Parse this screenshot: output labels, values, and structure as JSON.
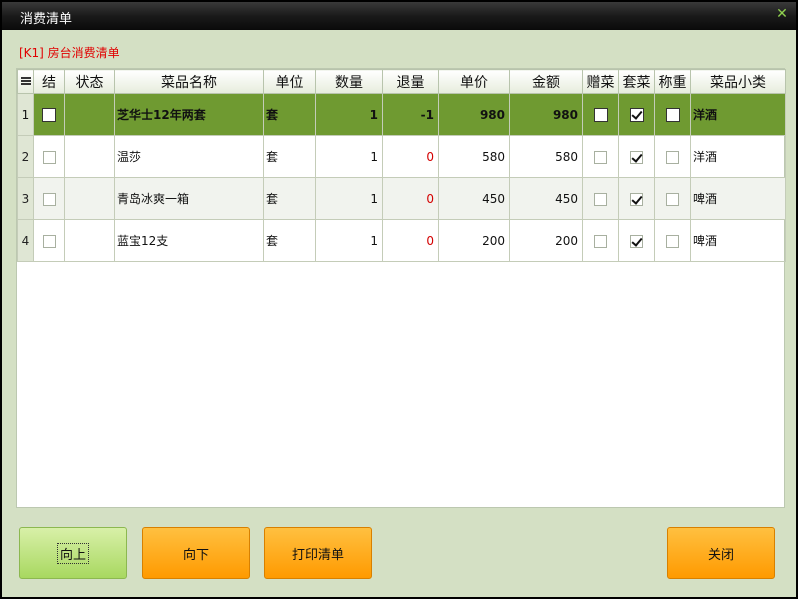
{
  "window": {
    "title": "消费清单",
    "close_glyph": "✕"
  },
  "subtitle": "[K1] 房台消费清单",
  "table": {
    "headers": [
      "结",
      "状态",
      "菜品名称",
      "单位",
      "数量",
      "退量",
      "单价",
      "金额",
      "赠菜",
      "套菜",
      "称重",
      "菜品小类"
    ],
    "rows": [
      {
        "idx": "1",
        "jie": false,
        "status": "",
        "name": "芝华士12年两套",
        "unit": "套",
        "qty": "1",
        "ret": "-1",
        "price": "980",
        "amount": "980",
        "gift": false,
        "set": true,
        "weigh": false,
        "category": "洋酒"
      },
      {
        "idx": "2",
        "jie": false,
        "status": "",
        "name": "温莎",
        "unit": "套",
        "qty": "1",
        "ret": "0",
        "price": "580",
        "amount": "580",
        "gift": false,
        "set": true,
        "weigh": false,
        "category": "洋酒"
      },
      {
        "idx": "3",
        "jie": false,
        "status": "",
        "name": "青岛冰爽一箱",
        "unit": "套",
        "qty": "1",
        "ret": "0",
        "price": "450",
        "amount": "450",
        "gift": false,
        "set": true,
        "weigh": false,
        "category": "啤酒"
      },
      {
        "idx": "4",
        "jie": false,
        "status": "",
        "name": "蓝宝12支",
        "unit": "套",
        "qty": "1",
        "ret": "0",
        "price": "200",
        "amount": "200",
        "gift": false,
        "set": true,
        "weigh": false,
        "category": "啤酒"
      }
    ]
  },
  "buttons": {
    "up": "向上",
    "down": "向下",
    "print": "打印清单",
    "close": "关闭"
  },
  "colors": {
    "selected_row": "#6f9a31",
    "button_orange": "#ff9a00",
    "button_green": "#a8d860",
    "negative_red": "#d40000"
  }
}
